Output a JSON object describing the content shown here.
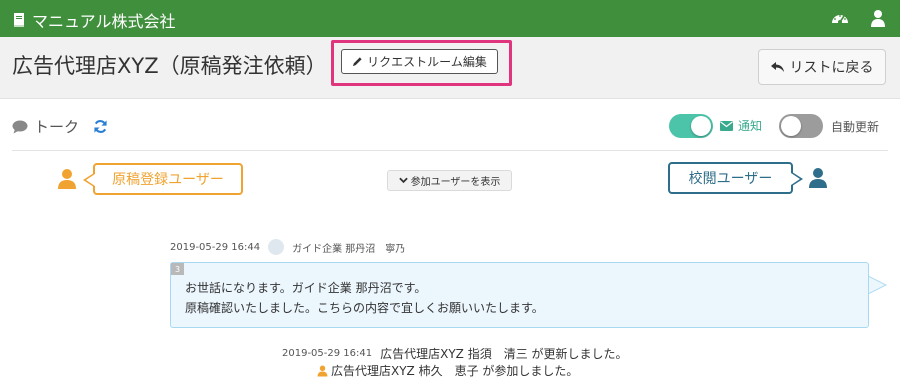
{
  "app": {
    "title": "マニュアル株式会社"
  },
  "header": {
    "page_title": "広告代理店XYZ（原稿発注依頼）",
    "edit_room_label": "リクエストルーム編集",
    "back_label": "リストに戻る"
  },
  "talk": {
    "label": "トーク",
    "notify_label": "通知",
    "notify_on": true,
    "auto_refresh_label": "自動更新",
    "auto_refresh_on": false
  },
  "roles": {
    "left_label": "原稿登録ユーザー",
    "right_label": "校閲ユーザー",
    "show_users_label": "参加ユーザーを表示"
  },
  "messages": [
    {
      "number": "3",
      "timestamp": "2019-05-29 16:44",
      "author": "ガイド企業 那丹沼　寧乃",
      "lines": [
        "お世話になります。ガイド企業 那丹沼です。",
        "原稿確認いたしました。こちらの内容で宜しくお願いいたします。"
      ]
    }
  ],
  "logs": [
    {
      "timestamp": "2019-05-29 16:41",
      "text": "広告代理店XYZ 指須　清三 が更新しました。"
    },
    {
      "text": "広告代理店XYZ 柿久　恵子 が参加しました。"
    }
  ],
  "colors": {
    "topbar": "#3f8f3c",
    "highlight": "#e0347e",
    "left_role": "#f0a331",
    "right_role": "#2f6e8a",
    "toggle_on": "#4cc4a9",
    "bubble_bg": "#ebf6fd"
  },
  "icons": {
    "brand": "book-icon",
    "dashboard": "dashboard-icon",
    "user_menu": "user-icon",
    "edit": "pencil-icon",
    "back": "reply-icon",
    "talk": "comment-icon",
    "refresh": "refresh-icon",
    "notify": "envelope-icon",
    "show_users": "chevron-down-icon"
  }
}
